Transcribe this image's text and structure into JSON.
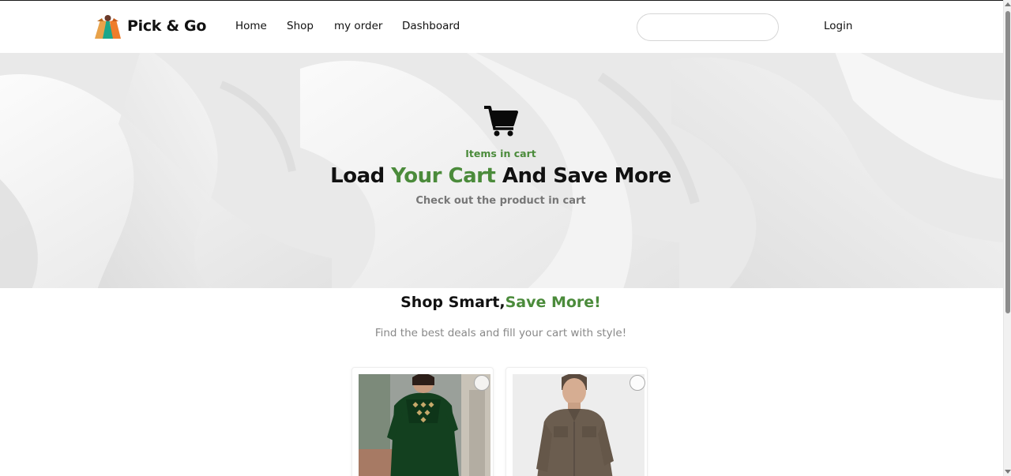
{
  "brand": {
    "name": "Pick & Go"
  },
  "nav": {
    "items": [
      {
        "label": "Home"
      },
      {
        "label": "Shop"
      },
      {
        "label": "my order"
      },
      {
        "label": "Dashboard"
      }
    ],
    "search": {
      "value": "",
      "placeholder": ""
    },
    "login_label": "Login"
  },
  "hero": {
    "icon": "shopping-cart-icon",
    "eyebrow": "Items in cart",
    "title_part1": "Load ",
    "title_accent": "Your Cart",
    "title_part2": " And Save More",
    "subtitle": "Check out the product in cart"
  },
  "section": {
    "title_main": "Shop Smart,",
    "title_accent": "Save More!",
    "subtitle": "Find the best deals and fill your cart with style!"
  },
  "products": [
    {
      "image": "green-embroidered-kurta-photo",
      "selected": false
    },
    {
      "image": "brown-mens-shirt-photo",
      "selected": false
    }
  ],
  "colors": {
    "accent": "#4b8b3b",
    "text": "#111111",
    "muted": "#888888"
  }
}
